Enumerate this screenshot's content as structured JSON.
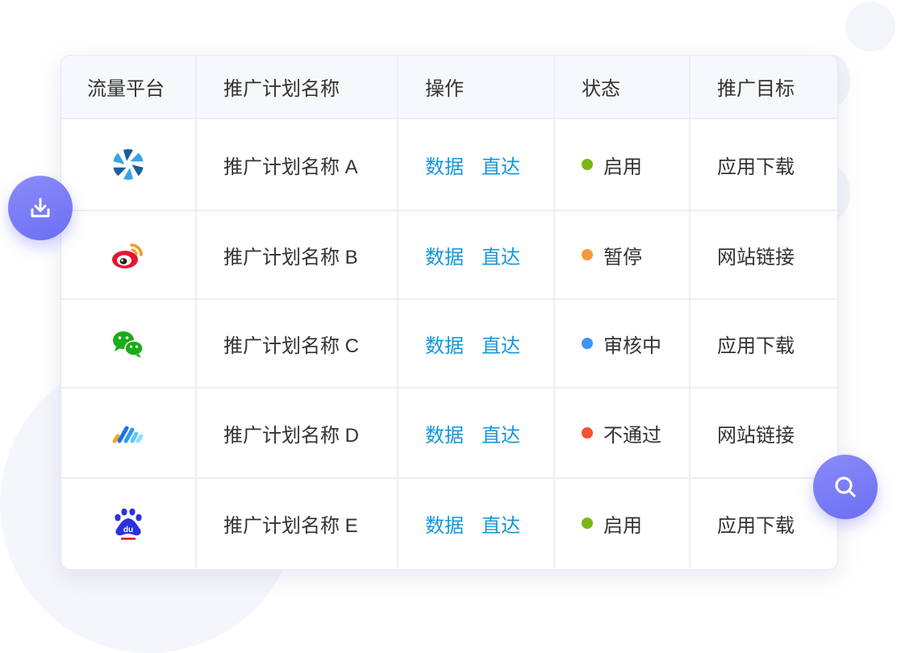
{
  "table": {
    "headers": {
      "platform": "流量平台",
      "plan_name": "推广计划名称",
      "actions": "操作",
      "status": "状态",
      "goal": "推广目标"
    },
    "rows": [
      {
        "platform_icon": "pinwheel-logo-icon",
        "plan_name": "推广计划名称 A",
        "action_data": "数据",
        "action_direct": "直达",
        "status_label": "启用",
        "status_color": "#7cb518",
        "goal": "应用下载"
      },
      {
        "platform_icon": "weibo-logo-icon",
        "plan_name": "推广计划名称 B",
        "action_data": "数据",
        "action_direct": "直达",
        "status_label": "暂停",
        "status_color": "#f5973d",
        "goal": "网站链接"
      },
      {
        "platform_icon": "wechat-logo-icon",
        "plan_name": "推广计划名称 C",
        "action_data": "数据",
        "action_direct": "直达",
        "status_label": "审核中",
        "status_color": "#3d96f5",
        "goal": "应用下载"
      },
      {
        "platform_icon": "bars-logo-icon",
        "plan_name": "推广计划名称 D",
        "action_data": "数据",
        "action_direct": "直达",
        "status_label": "不通过",
        "status_color": "#f4532f",
        "goal": "网站链接"
      },
      {
        "platform_icon": "baidu-logo-icon",
        "plan_name": "推广计划名称 E",
        "action_data": "数据",
        "action_direct": "直达",
        "status_label": "启用",
        "status_color": "#7cb518",
        "goal": "应用下载"
      }
    ]
  },
  "colors": {
    "link": "#1296db",
    "accent": "#6b6ff3"
  },
  "floating_buttons": {
    "download_icon": "download-icon",
    "search_icon": "search-icon"
  }
}
